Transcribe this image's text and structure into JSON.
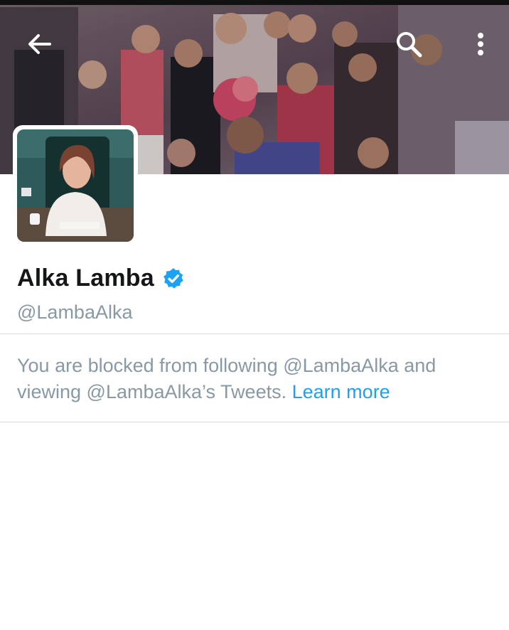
{
  "header": {
    "back_icon": "arrow-left-icon",
    "search_icon": "search-icon",
    "more_icon": "more-vertical-icon"
  },
  "profile": {
    "name": "Alka Lamba",
    "verified_icon": "verified-badge-icon",
    "handle": "@LambaAlka"
  },
  "notice": {
    "text": "You are blocked from following @LambaAlka and viewing @LambaAlka’s Tweets.",
    "link_label": "Learn more"
  },
  "colors": {
    "verified": "#1da1f2",
    "link": "#1da1f2",
    "muted_text": "#8899a6",
    "name_text": "#14171a"
  }
}
